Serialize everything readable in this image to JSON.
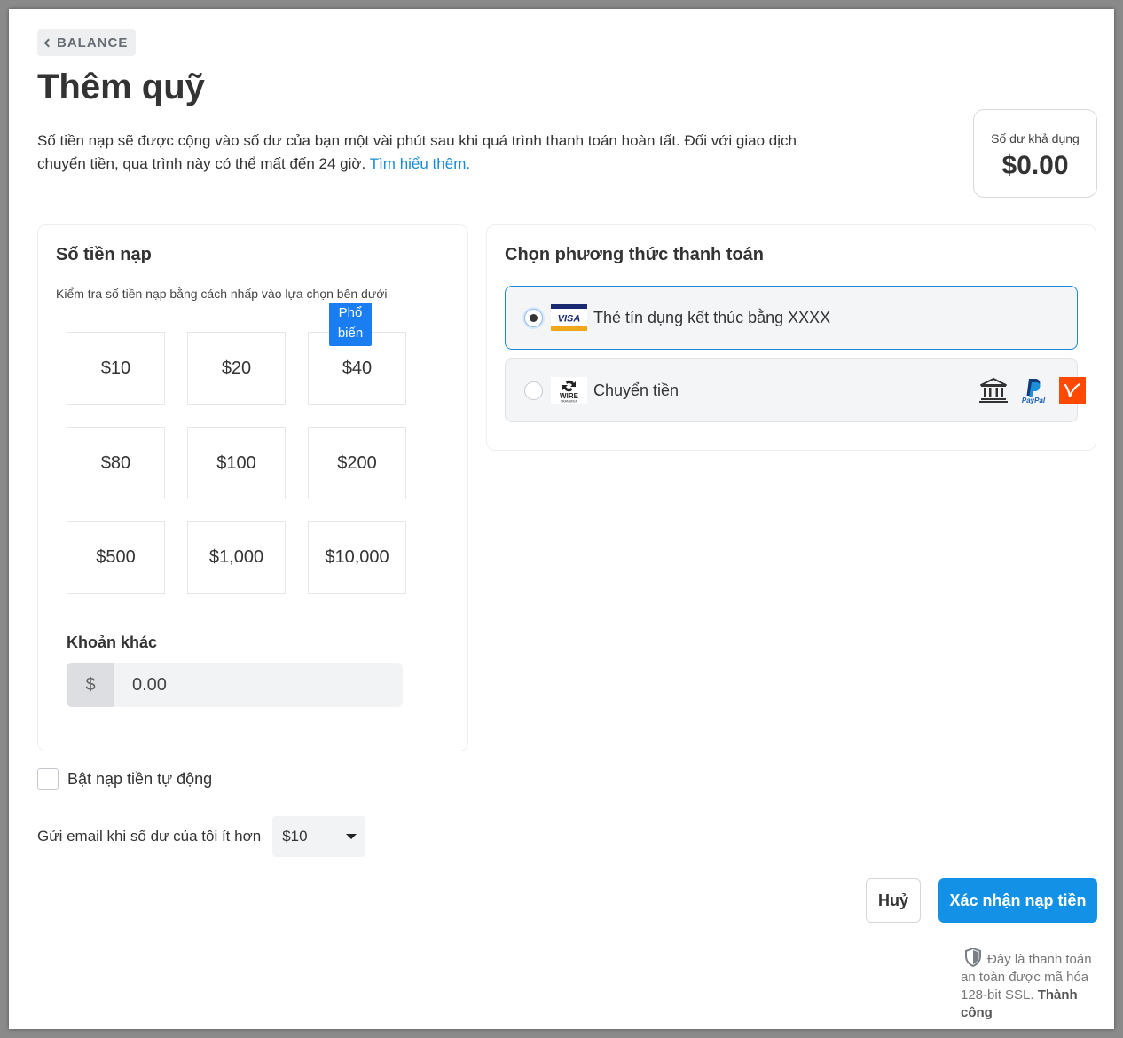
{
  "header": {
    "back_label": "BALANCE",
    "title": "Thêm quỹ",
    "intro_text": "Số tiền nạp sẽ được cộng vào số dư của bạn một vài phút sau khi quá trình thanh toán hoàn tất. Đối với giao dịch chuyển tiền, qua trình này có thể mất đến 24 giờ. ",
    "intro_link": "Tìm hiểu thêm."
  },
  "balance": {
    "label": "Số dư khả dụng",
    "value": "$0.00"
  },
  "amount_card": {
    "title": "Số tiền nạp",
    "hint": "Kiểm tra số tiền nạp bằng cách nhấp vào lựa chọn bên dưới",
    "popular_badge": "Phổ biến",
    "amounts": [
      "$10",
      "$20",
      "$40",
      "$80",
      "$100",
      "$200",
      "$500",
      "$1,000",
      "$10,000"
    ],
    "other_label": "Khoản khác",
    "currency_prefix": "$",
    "other_placeholder": "0.00"
  },
  "method_card": {
    "title": "Chọn phương thức thanh toán",
    "methods": [
      {
        "label": "Thẻ tín dụng kết thúc bằng XXXX",
        "selected": true,
        "icon": "visa-card-icon"
      },
      {
        "label": "Chuyển tiền",
        "selected": false,
        "icon": "wire-transfer-icon"
      }
    ],
    "visa_text": "VISA",
    "wire_text": "WIRE",
    "wire_subtext": "TRANSFER",
    "paypal_text": "PayPal",
    "extra_icons": [
      "bank-icon",
      "paypal-icon",
      "payoneer-icon"
    ]
  },
  "auto_topup": {
    "label": "Bật nạp tiền tự động",
    "checked": false
  },
  "email_alert": {
    "label": "Gửi email khi số dư của tôi ít hơn",
    "selected": "$10"
  },
  "actions": {
    "cancel_label": "Huỷ",
    "confirm_label": "Xác nhận nạp tiền"
  },
  "secure_note": {
    "text": "Đây là thanh toán an toàn được mã hóa 128-bit SSL. ",
    "bold": "Thành công"
  },
  "colors": {
    "accent": "#1291e6",
    "badge": "#1a7ef2",
    "link": "#1a8ad6"
  }
}
